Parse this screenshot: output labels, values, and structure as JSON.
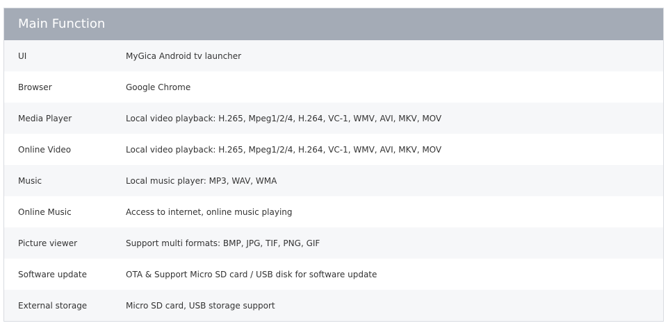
{
  "table": {
    "title": "Main Function",
    "rows": [
      {
        "label": "UI",
        "value": "MyGica Android tv launcher"
      },
      {
        "label": "Browser",
        "value": "Google Chrome"
      },
      {
        "label": "Media Player",
        "value": "Local video playback: H.265, Mpeg1/2/4, H.264, VC-1, WMV, AVI, MKV, MOV"
      },
      {
        "label": "Online Video",
        "value": "Local video playback: H.265, Mpeg1/2/4, H.264, VC-1, WMV, AVI, MKV, MOV"
      },
      {
        "label": "Music",
        "value": "Local music player: MP3, WAV, WMA"
      },
      {
        "label": "Online Music",
        "value": "Access to internet, online music playing"
      },
      {
        "label": "Picture viewer",
        "value": "Support multi formats: BMP, JPG, TIF, PNG, GIF"
      },
      {
        "label": "Software update",
        "value": "OTA & Support Micro SD card / USB disk for software update"
      },
      {
        "label": "External storage",
        "value": "Micro SD card, USB storage support"
      }
    ]
  }
}
